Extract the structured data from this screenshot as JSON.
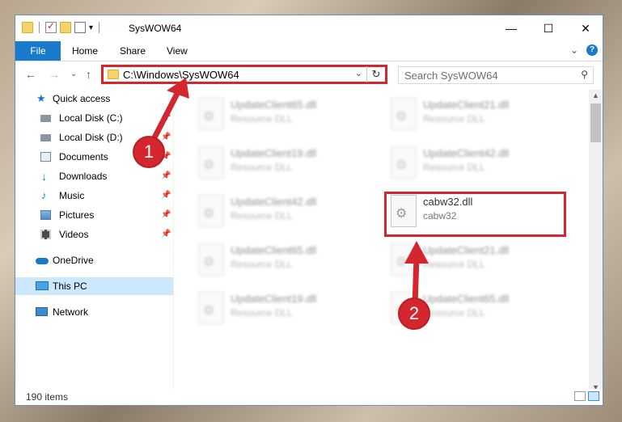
{
  "window": {
    "title": "SysWOW64",
    "minimize": "—",
    "maximize": "☐",
    "close": "✕"
  },
  "ribbon": {
    "tabs": [
      "File",
      "Home",
      "Share",
      "View"
    ],
    "collapse_glyph": "⌄",
    "help_glyph": "?"
  },
  "nav": {
    "back": "←",
    "forward": "→",
    "recent": "⌄",
    "up": "↑"
  },
  "address": {
    "path": "C:\\Windows\\SysWOW64",
    "dropdown": "⌄",
    "refresh": "↻"
  },
  "search": {
    "placeholder": "Search SysWOW64",
    "icon": "⚲"
  },
  "sidebar": {
    "items": [
      {
        "label": "Quick access",
        "icon": "star-icon",
        "pinned": false
      },
      {
        "label": "Local Disk (C:)",
        "icon": "drive-icon",
        "pinned": true
      },
      {
        "label": "Local Disk (D:)",
        "icon": "drive-icon",
        "pinned": true
      },
      {
        "label": "Documents",
        "icon": "documents-icon",
        "pinned": true
      },
      {
        "label": "Downloads",
        "icon": "download-icon",
        "pinned": true
      },
      {
        "label": "Music",
        "icon": "music-icon",
        "pinned": true
      },
      {
        "label": "Pictures",
        "icon": "pictures-icon",
        "pinned": true
      },
      {
        "label": "Videos",
        "icon": "videos-icon",
        "pinned": true
      },
      {
        "label": "OneDrive",
        "icon": "cloud-icon",
        "pinned": false
      },
      {
        "label": "This PC",
        "icon": "computer-icon",
        "pinned": false,
        "selected": true
      },
      {
        "label": "Network",
        "icon": "network-icon",
        "pinned": false
      }
    ],
    "pin_glyph": "📌"
  },
  "files": [
    {
      "name": "UpdateClient65.dll",
      "desc": "Resource DLL",
      "blurred": true
    },
    {
      "name": "UpdateClient21.dll",
      "desc": "Resource DLL",
      "blurred": true
    },
    {
      "name": "UpdateClient19.dll",
      "desc": "Resource DLL",
      "blurred": true
    },
    {
      "name": "UpdateClient42.dll",
      "desc": "Resource DLL",
      "blurred": true
    },
    {
      "name": "UpdateClient42.dll",
      "desc": "Resource DLL",
      "blurred": true
    },
    {
      "name": "cabw32.dll",
      "desc": "cabw32",
      "blurred": false
    },
    {
      "name": "UpdateClient65.dll",
      "desc": "Resource DLL",
      "blurred": true
    },
    {
      "name": "UpdateClient21.dll",
      "desc": "Resource DLL",
      "blurred": true
    },
    {
      "name": "UpdateClient19.dll",
      "desc": "Resource DLL",
      "blurred": true
    },
    {
      "name": "UpdateClient65.dll",
      "desc": "Resource DLL",
      "blurred": true
    }
  ],
  "status": {
    "item_count": "190 items"
  },
  "annotations": {
    "step1": "1",
    "step2": "2",
    "color": "#d3262e"
  }
}
